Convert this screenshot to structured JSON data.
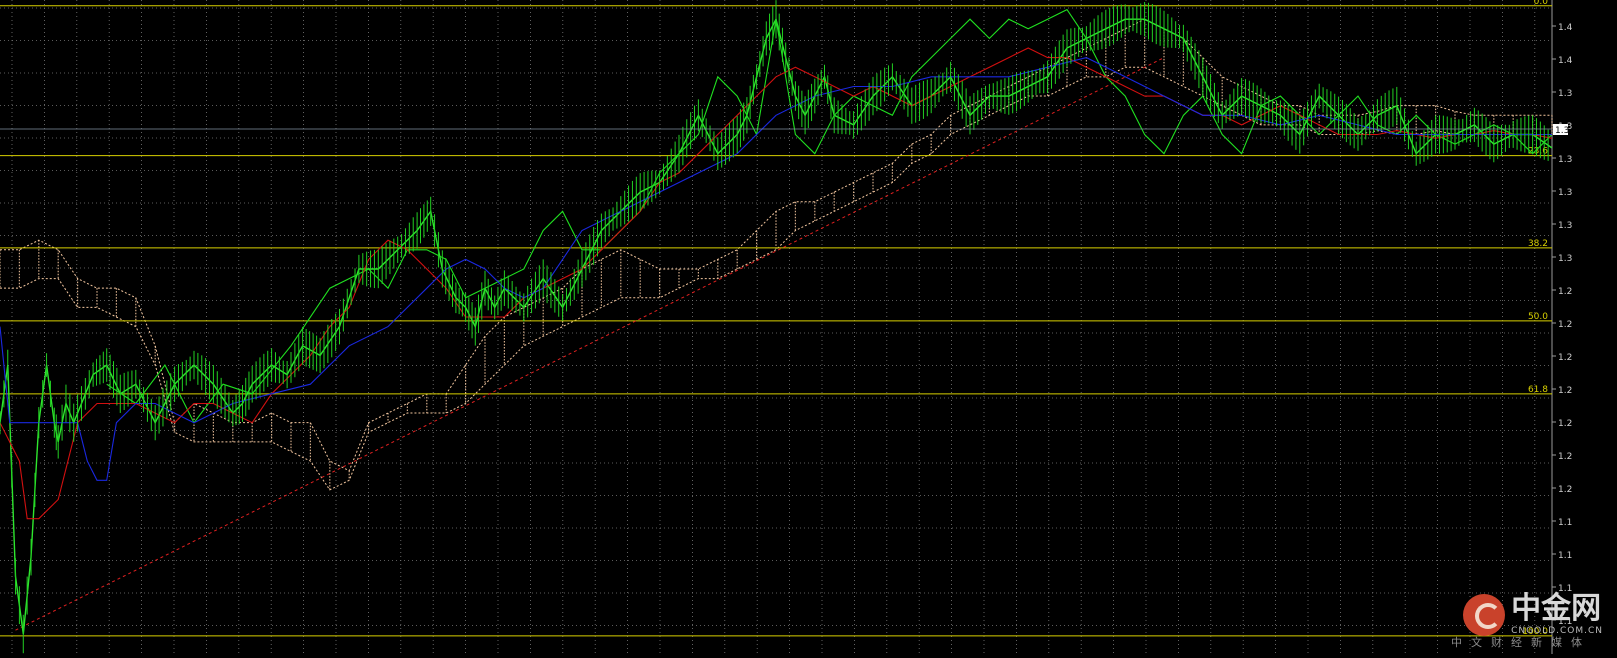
{
  "chart_data": {
    "type": "line",
    "title": "",
    "instrument_note": "",
    "xlabel": "",
    "ylabel": "",
    "x_count": 800,
    "ylim": [
      1.09,
      1.42
    ],
    "y_ticks": [
      "1.4",
      "1.4",
      "1.3",
      "1.3",
      "1.3",
      "1.3",
      "1.3",
      "1.3",
      "1.2",
      "1.2",
      "1.2",
      "1.2",
      "1.2",
      "1.2",
      "1.2",
      "1.1",
      "1.1",
      "1.1",
      "1.1"
    ],
    "current_price_label": "1.3",
    "grid": true,
    "fibonacci": {
      "color": "#d8d000",
      "levels": [
        {
          "label": "0.0",
          "value": 1.417
        },
        {
          "label": "23.6",
          "value": 1.339
        },
        {
          "label": "38.2",
          "value": 1.291
        },
        {
          "label": "50.0",
          "value": 1.253
        },
        {
          "label": "61.8",
          "value": 1.215
        },
        {
          "label": "100.0",
          "value": 1.089
        }
      ]
    },
    "trendline": {
      "color": "#e02020",
      "style": "dashed",
      "x": [
        8,
        600
      ],
      "y": [
        1.092,
        1.39
      ]
    },
    "series": [
      {
        "color": "#2ee62e",
        "x": [
          0,
          4,
          8,
          12,
          16,
          20,
          24,
          28,
          30,
          34,
          38,
          42,
          48,
          55,
          62,
          70,
          80,
          90,
          100,
          110,
          120,
          125,
          130,
          140,
          148,
          156,
          165,
          175,
          185,
          195,
          205,
          215,
          222,
          228,
          235,
          240,
          245,
          250,
          255,
          260,
          270,
          280,
          290,
          300,
          310,
          320,
          330,
          340,
          350,
          360,
          370,
          380,
          385,
          390,
          395,
          400,
          405,
          410,
          415,
          420,
          425,
          430,
          440,
          450,
          460,
          470,
          480,
          490,
          500,
          510,
          520,
          530,
          540,
          550,
          560,
          570,
          580,
          590,
          600,
          610,
          620,
          630,
          640,
          650,
          660,
          670,
          680,
          690,
          700,
          710,
          720,
          730,
          740,
          750,
          760,
          770,
          780,
          790,
          800
        ],
        "y": [
          1.2,
          1.23,
          1.12,
          1.09,
          1.13,
          1.2,
          1.23,
          1.2,
          1.19,
          1.21,
          1.2,
          1.21,
          1.225,
          1.23,
          1.215,
          1.22,
          1.2,
          1.22,
          1.23,
          1.22,
          1.205,
          1.21,
          1.22,
          1.23,
          1.225,
          1.24,
          1.235,
          1.25,
          1.28,
          1.28,
          1.29,
          1.3,
          1.31,
          1.28,
          1.265,
          1.26,
          1.25,
          1.27,
          1.26,
          1.27,
          1.26,
          1.275,
          1.26,
          1.28,
          1.3,
          1.31,
          1.32,
          1.325,
          1.34,
          1.36,
          1.34,
          1.35,
          1.36,
          1.38,
          1.4,
          1.41,
          1.39,
          1.37,
          1.36,
          1.37,
          1.38,
          1.36,
          1.355,
          1.37,
          1.38,
          1.365,
          1.37,
          1.38,
          1.36,
          1.37,
          1.37,
          1.375,
          1.38,
          1.395,
          1.4,
          1.405,
          1.41,
          1.41,
          1.405,
          1.4,
          1.38,
          1.36,
          1.37,
          1.365,
          1.36,
          1.35,
          1.37,
          1.36,
          1.35,
          1.36,
          1.365,
          1.34,
          1.35,
          1.35,
          1.355,
          1.345,
          1.35,
          1.35,
          1.343
        ]
      },
      {
        "color": "#20e020",
        "x": [
          55,
          70,
          85,
          100,
          115,
          130,
          150,
          170,
          190,
          200,
          210,
          220,
          230,
          240,
          250,
          260,
          270,
          280,
          290,
          300,
          310,
          320,
          330,
          340,
          350,
          360,
          370,
          380,
          385,
          390,
          395,
          400,
          410,
          420,
          430,
          440,
          450,
          460,
          470,
          480,
          490,
          500,
          510,
          520,
          530,
          540,
          550,
          560,
          570,
          580,
          590,
          600,
          610,
          620,
          630,
          640,
          650,
          660,
          670,
          680,
          690,
          700,
          710,
          720,
          730,
          740,
          750,
          760,
          770,
          780,
          790,
          800
        ],
        "y": [
          1.22,
          1.21,
          1.23,
          1.2,
          1.22,
          1.215,
          1.24,
          1.27,
          1.28,
          1.27,
          1.29,
          1.29,
          1.285,
          1.265,
          1.27,
          1.275,
          1.28,
          1.3,
          1.31,
          1.29,
          1.29,
          1.3,
          1.31,
          1.33,
          1.34,
          1.35,
          1.38,
          1.37,
          1.36,
          1.35,
          1.38,
          1.41,
          1.35,
          1.34,
          1.36,
          1.37,
          1.365,
          1.36,
          1.38,
          1.39,
          1.4,
          1.41,
          1.4,
          1.41,
          1.405,
          1.41,
          1.415,
          1.4,
          1.38,
          1.37,
          1.35,
          1.34,
          1.36,
          1.37,
          1.35,
          1.34,
          1.365,
          1.37,
          1.36,
          1.35,
          1.36,
          1.37,
          1.355,
          1.35,
          1.36,
          1.35,
          1.345,
          1.35,
          1.355,
          1.35,
          1.34,
          1.35
        ]
      },
      {
        "color": "#d21010",
        "x": [
          0,
          10,
          14,
          20,
          30,
          40,
          50,
          60,
          70,
          80,
          90,
          100,
          110,
          120,
          130,
          140,
          150,
          160,
          170,
          180,
          190,
          200,
          210,
          220,
          230,
          240,
          250,
          260,
          270,
          280,
          290,
          300,
          310,
          320,
          330,
          340,
          350,
          360,
          370,
          380,
          390,
          400,
          410,
          420,
          430,
          440,
          450,
          460,
          470,
          480,
          490,
          500,
          510,
          520,
          530,
          540,
          550,
          560,
          570,
          580,
          590,
          600,
          610,
          620,
          630,
          640,
          650,
          660,
          670,
          680,
          690,
          700,
          710,
          720,
          730,
          740,
          750,
          760,
          770,
          780,
          790,
          800
        ],
        "y": [
          1.2,
          1.18,
          1.15,
          1.15,
          1.16,
          1.2,
          1.21,
          1.21,
          1.21,
          1.205,
          1.2,
          1.21,
          1.21,
          1.205,
          1.2,
          1.215,
          1.225,
          1.235,
          1.25,
          1.26,
          1.285,
          1.295,
          1.29,
          1.28,
          1.27,
          1.255,
          1.255,
          1.255,
          1.265,
          1.27,
          1.275,
          1.28,
          1.29,
          1.3,
          1.31,
          1.325,
          1.33,
          1.34,
          1.35,
          1.36,
          1.37,
          1.38,
          1.385,
          1.38,
          1.375,
          1.37,
          1.375,
          1.37,
          1.365,
          1.37,
          1.375,
          1.38,
          1.385,
          1.39,
          1.395,
          1.39,
          1.39,
          1.385,
          1.38,
          1.375,
          1.37,
          1.37,
          1.365,
          1.36,
          1.36,
          1.355,
          1.36,
          1.365,
          1.36,
          1.355,
          1.35,
          1.35,
          1.35,
          1.352,
          1.35,
          1.348,
          1.35,
          1.35,
          1.352,
          1.35,
          1.35,
          1.348
        ]
      },
      {
        "color": "#1a28e0",
        "x": [
          0,
          5,
          8,
          20,
          40,
          45,
          50,
          55,
          60,
          70,
          80,
          100,
          120,
          140,
          160,
          180,
          200,
          210,
          220,
          230,
          240,
          250,
          260,
          270,
          280,
          290,
          300,
          320,
          340,
          360,
          380,
          400,
          420,
          440,
          460,
          480,
          500,
          520,
          540,
          560,
          580,
          600,
          620,
          640,
          660,
          680,
          700,
          720,
          740,
          760,
          780,
          800
        ],
        "y": [
          1.25,
          1.2,
          1.2,
          1.2,
          1.2,
          1.18,
          1.17,
          1.17,
          1.2,
          1.21,
          1.21,
          1.2,
          1.21,
          1.215,
          1.22,
          1.24,
          1.25,
          1.26,
          1.27,
          1.28,
          1.285,
          1.28,
          1.27,
          1.265,
          1.27,
          1.285,
          1.3,
          1.31,
          1.32,
          1.33,
          1.34,
          1.36,
          1.37,
          1.375,
          1.375,
          1.38,
          1.38,
          1.38,
          1.385,
          1.39,
          1.38,
          1.37,
          1.36,
          1.36,
          1.355,
          1.36,
          1.355,
          1.35,
          1.35,
          1.35,
          1.35,
          1.35
        ]
      }
    ],
    "cloud": {
      "color": "#f5c8a0",
      "x": [
        0,
        10,
        20,
        30,
        40,
        50,
        60,
        70,
        80,
        90,
        100,
        110,
        120,
        130,
        140,
        150,
        160,
        170,
        180,
        190,
        200,
        210,
        220,
        230,
        240,
        250,
        260,
        270,
        280,
        290,
        300,
        310,
        320,
        330,
        340,
        350,
        360,
        370,
        380,
        390,
        400,
        410,
        420,
        430,
        440,
        450,
        460,
        470,
        480,
        490,
        500,
        510,
        520,
        530,
        540,
        550,
        560,
        570,
        580,
        590,
        600,
        610,
        620,
        630,
        640,
        650,
        660,
        670,
        680,
        690,
        700,
        710,
        720,
        730,
        740,
        750,
        760,
        770,
        780,
        790,
        800
      ],
      "upper": [
        1.29,
        1.29,
        1.295,
        1.29,
        1.275,
        1.27,
        1.27,
        1.265,
        1.24,
        1.2,
        1.21,
        1.205,
        1.2,
        1.2,
        1.205,
        1.2,
        1.2,
        1.18,
        1.175,
        1.2,
        1.205,
        1.21,
        1.215,
        1.215,
        1.23,
        1.245,
        1.255,
        1.26,
        1.265,
        1.27,
        1.28,
        1.285,
        1.29,
        1.285,
        1.28,
        1.28,
        1.28,
        1.285,
        1.29,
        1.3,
        1.31,
        1.315,
        1.315,
        1.32,
        1.325,
        1.33,
        1.335,
        1.345,
        1.35,
        1.36,
        1.365,
        1.37,
        1.375,
        1.38,
        1.385,
        1.39,
        1.395,
        1.4,
        1.405,
        1.41,
        1.405,
        1.4,
        1.39,
        1.38,
        1.375,
        1.37,
        1.365,
        1.365,
        1.36,
        1.36,
        1.36,
        1.362,
        1.365,
        1.365,
        1.365,
        1.362,
        1.36,
        1.36,
        1.36,
        1.36,
        1.36
      ],
      "lower": [
        1.27,
        1.27,
        1.275,
        1.275,
        1.26,
        1.26,
        1.255,
        1.25,
        1.23,
        1.195,
        1.19,
        1.19,
        1.19,
        1.19,
        1.19,
        1.185,
        1.18,
        1.165,
        1.17,
        1.195,
        1.2,
        1.205,
        1.205,
        1.205,
        1.21,
        1.22,
        1.23,
        1.24,
        1.245,
        1.25,
        1.255,
        1.26,
        1.265,
        1.265,
        1.265,
        1.27,
        1.275,
        1.275,
        1.28,
        1.285,
        1.29,
        1.3,
        1.305,
        1.31,
        1.315,
        1.32,
        1.325,
        1.335,
        1.34,
        1.35,
        1.355,
        1.36,
        1.365,
        1.37,
        1.37,
        1.375,
        1.38,
        1.38,
        1.385,
        1.385,
        1.38,
        1.375,
        1.37,
        1.365,
        1.36,
        1.355,
        1.355,
        1.355,
        1.35,
        1.35,
        1.35,
        1.352,
        1.35,
        1.35,
        1.352,
        1.35,
        1.35,
        1.35,
        1.35,
        1.35,
        1.35
      ]
    }
  },
  "branding": {
    "logo_text": "中金网",
    "domain": "CNGOLD.COM.CN",
    "slogan": "中文财经新媒体"
  }
}
